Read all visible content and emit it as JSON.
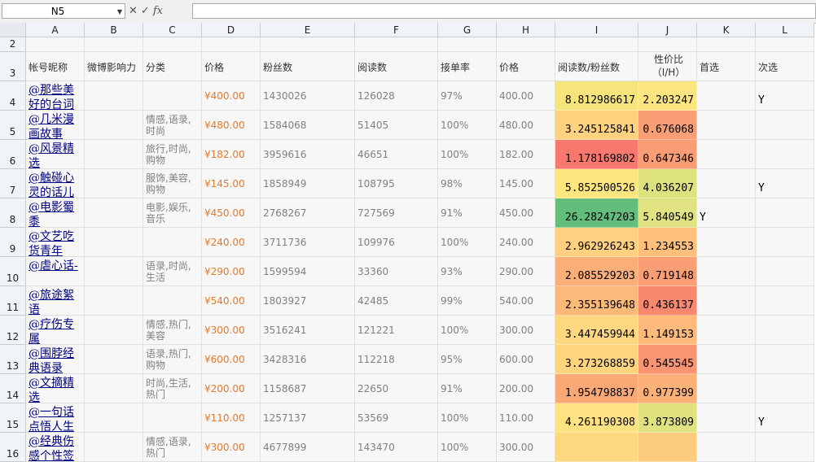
{
  "name_box": {
    "value": "N5"
  },
  "formula_bar": {
    "value": ""
  },
  "columns": [
    "A",
    "B",
    "C",
    "D",
    "E",
    "F",
    "G",
    "H",
    "I",
    "J",
    "K",
    "L"
  ],
  "header_row": {
    "row_num": "3",
    "A": "帐号昵称",
    "B": "微博影响力",
    "C": "分类",
    "D": "价格",
    "E": "粉丝数",
    "F": "阅读数",
    "G": "接单率",
    "H": "价格",
    "I": "阅读数/粉丝数",
    "J": "性价比\n（I/H）",
    "K": "首选",
    "L": "次选"
  },
  "rows": [
    {
      "row": "4",
      "name": "@那些美\n好的台词",
      "cat": "",
      "price": "¥400.00",
      "fans": "1430026",
      "reads": "126028",
      "rate": "97%",
      "h": "400.00",
      "ratio": "8.812986617",
      "value": "2.203247",
      "first": "",
      "second": "Y",
      "colorI": "#f5e57a",
      "colorJ": "#fde57f"
    },
    {
      "row": "5",
      "name": "@几米漫\n画故事",
      "cat": "情感,语录,\n时尚",
      "price": "¥480.00",
      "fans": "1584068",
      "reads": "51405",
      "rate": "100%",
      "h": "480.00",
      "ratio": "3.245125841",
      "value": "0.676068",
      "first": "",
      "second": "",
      "colorI": "#fed27f",
      "colorJ": "#fa9f75"
    },
    {
      "row": "6",
      "name": "@风景精\n选",
      "cat": "旅行,时尚,\n购物",
      "price": "¥182.00",
      "fans": "3959616",
      "reads": "46651",
      "rate": "100%",
      "h": "182.00",
      "ratio": "1.178169802",
      "value": "0.647346",
      "first": "",
      "second": "",
      "colorI": "#f8786e",
      "colorJ": "#fa9c74"
    },
    {
      "row": "7",
      "name": "@触碰心\n灵的话儿",
      "cat": "服饰,美容,\n购物",
      "price": "¥145.00",
      "fans": "1858949",
      "reads": "108795",
      "rate": "98%",
      "h": "145.00",
      "ratio": "5.852500526",
      "value": "4.036207",
      "first": "",
      "second": "Y",
      "colorI": "#fde67f",
      "colorJ": "#dde27f"
    },
    {
      "row": "8",
      "name": "@电影蜀\n黍",
      "cat": "电影,娱乐,\n音乐",
      "price": "¥450.00",
      "fans": "2768267",
      "reads": "727569",
      "rate": "91%",
      "h": "450.00",
      "ratio": "26.28247203",
      "value": "5.840549",
      "first": "Y",
      "second": "",
      "colorI": "#63be7b",
      "colorJ": "#e1e383"
    },
    {
      "row": "9",
      "name": "@文艺吃\n货青年",
      "cat": "",
      "price": "¥240.00",
      "fans": "3711736",
      "reads": "109976",
      "rate": "100%",
      "h": "240.00",
      "ratio": "2.962926243",
      "value": "1.234553",
      "first": "",
      "second": "",
      "colorI": "#fed07f",
      "colorJ": "#fec07b"
    },
    {
      "row": "10",
      "name": "@虐心话-",
      "cat": "语录,时尚,\n生活",
      "price": "¥290.00",
      "fans": "1599594",
      "reads": "33360",
      "rate": "93%",
      "h": "290.00",
      "ratio": "2.085529203",
      "value": "0.719148",
      "first": "",
      "second": "",
      "colorI": "#fbae78",
      "colorJ": "#fa9f75"
    },
    {
      "row": "11",
      "name": "@旅途絮\n语",
      "cat": "",
      "price": "¥540.00",
      "fans": "1803927",
      "reads": "42485",
      "rate": "99%",
      "h": "540.00",
      "ratio": "2.355139648",
      "value": "0.436137",
      "first": "",
      "second": "",
      "colorI": "#fcba7a",
      "colorJ": "#f8896f"
    },
    {
      "row": "12",
      "name": "@疗伤专\n属",
      "cat": "情感,热门,\n美容",
      "price": "¥300.00",
      "fans": "3516241",
      "reads": "121221",
      "rate": "100%",
      "h": "300.00",
      "ratio": "3.447459944",
      "value": "1.149153",
      "first": "",
      "second": "",
      "colorI": "#fed880",
      "colorJ": "#fdba7a"
    },
    {
      "row": "13",
      "name": "@围脖经\n典语录",
      "cat": "语录,热门,\n购物",
      "price": "¥600.00",
      "fans": "3428316",
      "reads": "112218",
      "rate": "95%",
      "h": "600.00",
      "ratio": "3.273268859",
      "value": "0.545545",
      "first": "",
      "second": "",
      "colorI": "#fed47f",
      "colorJ": "#f99572"
    },
    {
      "row": "14",
      "name": "@文摘精\n选",
      "cat": "时尚,生活,\n热门",
      "price": "¥200.00",
      "fans": "1158687",
      "reads": "22650",
      "rate": "91%",
      "h": "200.00",
      "ratio": "1.954798837",
      "value": "0.977399",
      "first": "",
      "second": "",
      "colorI": "#faa876",
      "colorJ": "#fcb178"
    },
    {
      "row": "15",
      "name": "@一句话\n点悟人生",
      "cat": "",
      "price": "¥110.00",
      "fans": "1257137",
      "reads": "53569",
      "rate": "100%",
      "h": "110.00",
      "ratio": "4.261190308",
      "value": "3.873809",
      "first": "",
      "second": "Y",
      "colorI": "#ffe281",
      "colorJ": "#dfe27f"
    },
    {
      "row": "16",
      "name": "@经典伤\n感个性签",
      "cat": "情感,语录,\n热门",
      "price": "¥300.00",
      "fans": "4677899",
      "reads": "143470",
      "rate": "100%",
      "h": "300.00",
      "ratio": "",
      "value": "",
      "first": "",
      "second": "",
      "colorI": "#fed880",
      "colorJ": "#fdcb7e"
    }
  ]
}
